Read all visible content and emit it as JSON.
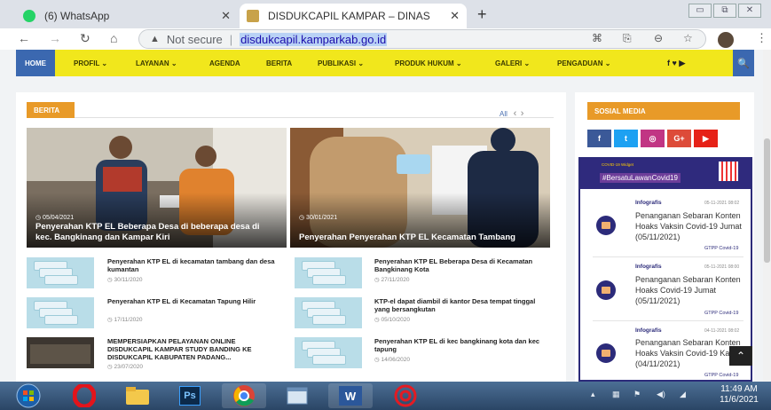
{
  "browser": {
    "tabs": [
      {
        "title": "(6) WhatsApp",
        "favicon_color": "#25d366"
      },
      {
        "title": "DISDUKCAPIL KAMPAR – DINAS",
        "favicon_color": "#c8a24a"
      }
    ],
    "new_tab": "+",
    "close_glyph": "✕",
    "address": {
      "security": "Not secure",
      "separator": "|",
      "url": "disdukcapil.kamparkab.go.id"
    }
  },
  "site": {
    "menu": [
      "HOME",
      "PROFIL ⌄",
      "LAYANAN ⌄",
      "AGENDA",
      "BERITA",
      "PUBLIKASI ⌄",
      "PRODUK HUKUM ⌄",
      "GALERI ⌄",
      "PENGADUAN ⌄"
    ],
    "menu_social": "f ♥ ▶",
    "search_glyph": "🔍",
    "section": {
      "title": "BERITA",
      "all": "All",
      "prev": "‹",
      "next": "›"
    },
    "featured": [
      {
        "date": "◷ 05/04/2021",
        "caption": "Penyerahan KTP EL Beberapa Desa di beberapa desa di kec. Bangkinang dan Kampar Kiri"
      },
      {
        "date": "◷ 30/01/2021",
        "caption": "Penyerahan Penyerahan KTP EL Kecamatan Tambang"
      }
    ],
    "news": [
      {
        "title": "Penyerahan KTP EL di kecamatan tambang dan desa kumantan",
        "date": "◷ 30/11/2020"
      },
      {
        "title": "Penyerahan KTP EL Beberapa Desa di Kecamatan Bangkinang Kota",
        "date": "◷ 27/11/2020"
      },
      {
        "title": "Penyerahan KTP EL di Kecamatan Tapung Hilir",
        "date": "◷ 17/11/2020"
      },
      {
        "title": "KTP-el dapat diambil di kantor Desa tempat tinggal yang bersangkutan",
        "date": "◷ 05/10/2020"
      },
      {
        "title": "MEMPERSIAPKAN PELAYANAN ONLINE DISDUKCAPIL KAMPAR STUDY BANDING KE DISDUKCAPIL KABUPATEN PADANG...",
        "date": "◷ 23/07/2020"
      },
      {
        "title": "Penyerahan KTP EL di kec bangkinang kota dan kec tapung",
        "date": "◷ 14/06/2020"
      }
    ],
    "sidebar": {
      "title": "SOSIAL MEDIA",
      "buttons": [
        {
          "label": "f",
          "color": "#3b5998"
        },
        {
          "label": "t",
          "color": "#1da1f2"
        },
        {
          "label": "◎",
          "color": "#c13584"
        },
        {
          "label": "G+",
          "color": "#dd4b39"
        },
        {
          "label": "▶",
          "color": "#e62117"
        }
      ]
    },
    "covid": {
      "banner_small": "COVID-19 Widget",
      "banner_tag": "#BersatuLawanCovid19",
      "items": [
        {
          "category": "Infografis",
          "datetime": "05-11-2021 08:02",
          "text": "Penanganan Sebaran Konten Hoaks Vaksin Covid-19 Jumat (05/11/2021)",
          "source": "GTPP Covid-19"
        },
        {
          "category": "Infografis",
          "datetime": "05-11-2021 08:00",
          "text": "Penanganan Sebaran Konten Hoaks Covid-19 Jumat (05/11/2021)",
          "source": "GTPP Covid-19"
        },
        {
          "category": "Infografis",
          "datetime": "04-11-2021 08:02",
          "text": "Penanganan Sebaran Konten Hoaks Vaksin Covid-19 Kamis (04/11/2021)",
          "source": "GTPP Covid-19"
        }
      ]
    },
    "back_to_top": "⌃"
  },
  "taskbar": {
    "apps": [
      "Start",
      "Opera",
      "Explorer",
      "Photoshop",
      "Chrome",
      "Window",
      "Word",
      "App"
    ],
    "clock_time": "11:49 AM",
    "clock_date": "11/6/2021"
  }
}
